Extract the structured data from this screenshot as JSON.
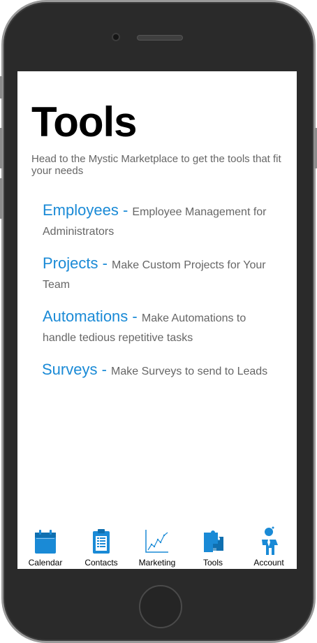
{
  "page": {
    "title": "Tools",
    "subtitle": "Head to the Mystic Marketplace to get the tools that fit your needs"
  },
  "tools": [
    {
      "name": "Employees",
      "separator": " - ",
      "description": "Employee Management for Administrators"
    },
    {
      "name": "Projects",
      "separator": " - ",
      "description": "Make Custom Projects for Your Team"
    },
    {
      "name": "Automations",
      "separator": " - ",
      "description": "Make Automations to handle tedious repetitive tasks"
    },
    {
      "name": "Surveys",
      "separator": " - ",
      "description": "Make Surveys to send to Leads"
    }
  ],
  "tabbar": [
    {
      "label": "Calendar",
      "icon": "calendar-icon"
    },
    {
      "label": "Contacts",
      "icon": "contacts-icon"
    },
    {
      "label": "Marketing",
      "icon": "chart-icon"
    },
    {
      "label": "Tools",
      "icon": "puzzle-icon"
    },
    {
      "label": "Account",
      "icon": "person-icon"
    }
  ],
  "colors": {
    "accent": "#1a8ad6",
    "text_muted": "#666666",
    "device_frame": "#2a2a2a"
  }
}
